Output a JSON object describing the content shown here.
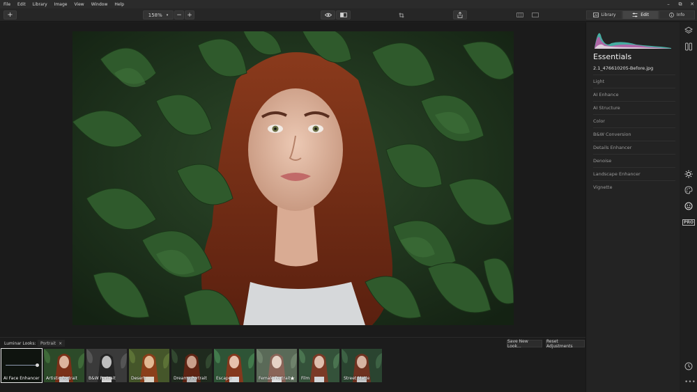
{
  "menu": [
    "File",
    "Edit",
    "Library",
    "Image",
    "View",
    "Window",
    "Help"
  ],
  "window_controls": {
    "minimize": "–",
    "maximize": "⧉",
    "close": "✕"
  },
  "toolbar": {
    "add_label": "+",
    "zoom_value": "158%",
    "zoom_out_label": "−",
    "zoom_in_label": "+",
    "tabs": [
      {
        "label": "Library",
        "icon": "library-icon"
      },
      {
        "label": "Edit",
        "icon": "sliders-icon",
        "active": true
      },
      {
        "label": "Info",
        "icon": "info-icon"
      }
    ]
  },
  "panel": {
    "title": "Essentials",
    "file_name": "2.1_476610205-Before.jpg",
    "sections": [
      "Light",
      "AI Enhance",
      "AI Structure",
      "Color",
      "B&W Conversion",
      "Details Enhancer",
      "Denoise",
      "Landscape Enhancer",
      "Vignette"
    ]
  },
  "rail_icons": [
    "layers-icon",
    "compare-icon",
    "sun-icon",
    "palette-icon",
    "smiley-icon",
    "pro-icon",
    "clock-icon"
  ],
  "pro_label": "PRO",
  "looks": {
    "label": "Luminar Looks:",
    "category": "Portrait",
    "category_close": "×",
    "save_button": "Save New Look...",
    "reset_button": "Reset Adjustments",
    "items": [
      {
        "label": "AI Face Enhancer",
        "selected": true
      },
      {
        "label": "Artistic Portrait"
      },
      {
        "label": "B&W Portrait"
      },
      {
        "label": "Desert"
      },
      {
        "label": "Dreamy Portrait"
      },
      {
        "label": "Escape"
      },
      {
        "label": "Female Portrait",
        "favorite": true
      },
      {
        "label": "Film"
      },
      {
        "label": "Street Matte"
      }
    ],
    "star_glyph": "★"
  },
  "more_glyph": "•••",
  "colors": {
    "accent": "#444444",
    "background": "#1e1e1e",
    "panel": "#232323"
  }
}
